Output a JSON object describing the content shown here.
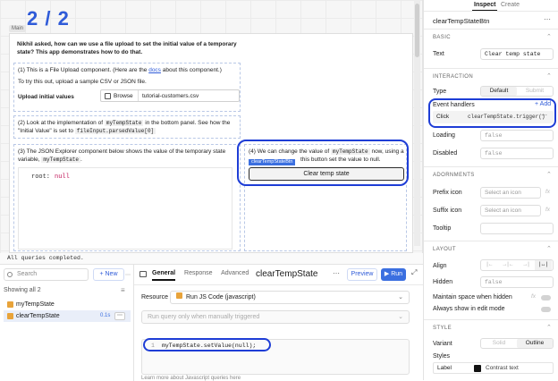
{
  "canvas": {
    "big_title": "2 / 2",
    "main_label": "Main",
    "heading": "Nikhil asked, how can we use a file upload to set the initial value of a temporary state? This app demonstrates how to do that.",
    "step1_a": "(1) This is a File Upload component. (Here are the",
    "step1_link": "docs",
    "step1_b": "about this component.)",
    "step1_c": "To try this out, upload a sample CSV or JSON file.",
    "upload_label": "Upload initial values",
    "browse_label": "Browse",
    "file_name": "tutorial-customers.csv",
    "step2_a": "(2) Look at the implementation of",
    "step2_code1": "myTempState",
    "step2_b": "in the bottom panel. See how the \"Initial Value\" is set to",
    "step2_code2": "fileInput.parsedValue[0]",
    "step3_a": "(3) The JSON Explorer component below shows the value of the temporary state variable,",
    "step3_code": "myTempState",
    "json_value_key": "root:",
    "json_value": "null",
    "step4_a": "(4) We can change the value of",
    "step4_code": "myTempState",
    "step4_b": "now, using a",
    "step4_c": "this button set the value to null.",
    "selected_tag": "clearTempStateBtn",
    "clear_button": "Clear temp state"
  },
  "status_text": "All queries completed.",
  "query_panel": {
    "search_placeholder": "Search",
    "new_button": "+ New",
    "showing": "Showing all 2",
    "queries": [
      {
        "name": "myTempState",
        "time": ""
      },
      {
        "name": "clearTempState",
        "time": "0.1s"
      }
    ]
  },
  "editor": {
    "tabs": [
      "General",
      "Response",
      "Advanced"
    ],
    "title": "clearTempState",
    "preview": "Preview",
    "run": "Run",
    "resource_label": "Resource",
    "resource_value": "Run JS Code (javascript)",
    "trigger_value": "Run query only when manually triggered",
    "line_no": "1",
    "code_line": "myTempState.setValue(null);",
    "learn_more": "Learn more about Javascript queries here"
  },
  "inspector": {
    "tabs": [
      "Inspect",
      "Create"
    ],
    "component_name": "clearTempStateBtn",
    "basic": "BASIC",
    "text_label": "Text",
    "text_value": "Clear temp state",
    "interaction": "INTERACTION",
    "type_label": "Type",
    "type_options": [
      "Default",
      "Submit"
    ],
    "event_handlers": "Event handlers",
    "add": "+ Add",
    "event_name": "Click",
    "event_action": "clearTempState.trigger()",
    "loading_label": "Loading",
    "loading_value": "false",
    "disabled_label": "Disabled",
    "disabled_value": "false",
    "adornments": "ADORNMENTS",
    "prefix_label": "Prefix icon",
    "prefix_value": "Select an icon",
    "suffix_label": "Suffix icon",
    "suffix_value": "Select an icon",
    "tooltip_label": "Tooltip",
    "layout": "LAYOUT",
    "align_label": "Align",
    "hidden_label": "Hidden",
    "hidden_value": "false",
    "maintain_label": "Maintain space when hidden",
    "always_label": "Always show in edit mode",
    "style": "STYLE",
    "variant_label": "Variant",
    "variant_options": [
      "Solid",
      "Outline"
    ],
    "styles_label": "Styles",
    "label_label": "Label",
    "label_value": "Contrast text"
  },
  "colors": {
    "accent": "#3b6fe0",
    "highlight": "#1e3dd6"
  }
}
